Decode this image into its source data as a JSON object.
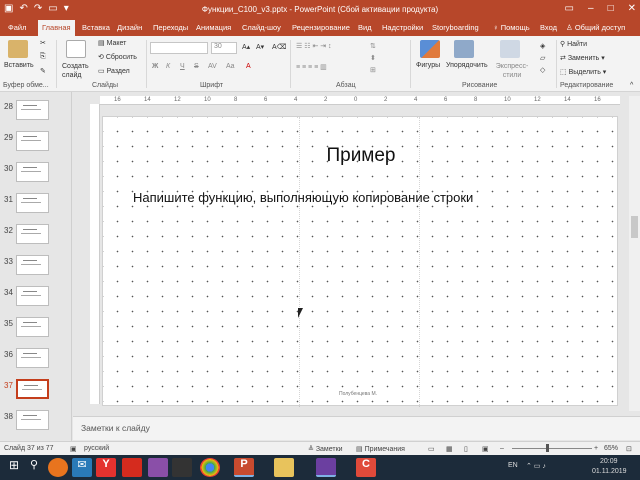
{
  "titlebar": {
    "title": "Функции_С100_v3.pptx - PowerPoint (Сбой активации продукта)"
  },
  "tabs": [
    {
      "label": "Файл"
    },
    {
      "label": "Главная"
    },
    {
      "label": "Вставка"
    },
    {
      "label": "Дизайн"
    },
    {
      "label": "Переходы"
    },
    {
      "label": "Анимация"
    },
    {
      "label": "Слайд-шоу"
    },
    {
      "label": "Рецензирование"
    },
    {
      "label": "Вид"
    },
    {
      "label": "Надстройки"
    },
    {
      "label": "Storyboarding"
    },
    {
      "label": "Помощь"
    },
    {
      "label": "Вход"
    },
    {
      "label": "Общий доступ"
    }
  ],
  "ribbon": {
    "paste_label": "Вставить",
    "new_slide_label": "Создать слайд",
    "layout_label": "Макет",
    "reset_label": "Сбросить",
    "section_label": "Раздел",
    "font_name": "",
    "font_size": "30",
    "bold": "Ж",
    "italic": "К",
    "underline": "Ч",
    "strike": "S",
    "shapes_label": "Фигуры",
    "arrange_label": "Упорядочить",
    "quick_styles_label": "Экспресс-стили",
    "find_label": "Найти",
    "replace_label": "Заменить",
    "select_label": "Выделить",
    "groups": {
      "clipboard": "Буфер обме...",
      "slides": "Слайды",
      "font": "Шрифт",
      "paragraph": "Абзац",
      "drawing": "Рисование",
      "editing": "Редактирование"
    }
  },
  "ruler": {
    "ticks": [
      "16",
      "14",
      "12",
      "10",
      "8",
      "6",
      "4",
      "2",
      "0",
      "2",
      "4",
      "6",
      "8",
      "10",
      "12",
      "14",
      "16"
    ]
  },
  "thumbnails": [
    {
      "num": "28",
      "active": false
    },
    {
      "num": "29",
      "active": false
    },
    {
      "num": "30",
      "active": false
    },
    {
      "num": "31",
      "active": false
    },
    {
      "num": "32",
      "active": false
    },
    {
      "num": "33",
      "active": false
    },
    {
      "num": "34",
      "active": false
    },
    {
      "num": "35",
      "active": false
    },
    {
      "num": "36",
      "active": false
    },
    {
      "num": "37",
      "active": true
    },
    {
      "num": "38",
      "active": false
    }
  ],
  "slide": {
    "title": "Пример",
    "body": "Напишите функцию, выполняющую копирование строки",
    "footer": "Полубенцева М."
  },
  "notes": {
    "placeholder": "Заметки к слайду"
  },
  "statusbar": {
    "slide_info": "Слайд 37 из 77",
    "language": "русский",
    "notes_button": "Заметки",
    "comments_button": "Примечания",
    "zoom": "65%"
  },
  "taskbar": {
    "lang": "EN",
    "time": "20:09",
    "date": "01.11.2019"
  },
  "colors": {
    "accent": "#b7472a",
    "active_thumb": "#c43e1c",
    "taskbar": "#1c2b3a"
  }
}
